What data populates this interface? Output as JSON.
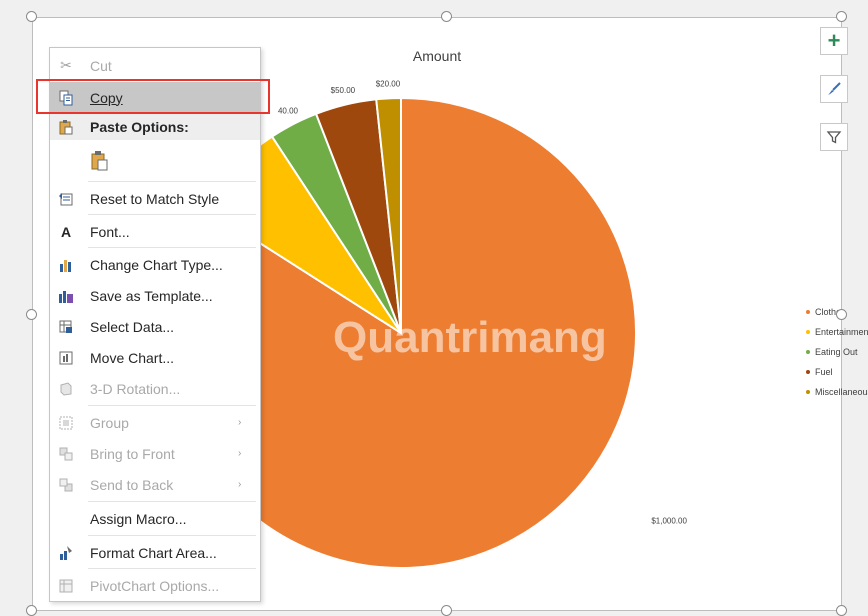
{
  "chart_data": {
    "type": "pie",
    "title": "Amount",
    "categories": [
      "Clothes",
      "Entertainment",
      "Eating Out",
      "Fuel",
      "Miscellaneous"
    ],
    "values": [
      1000,
      80,
      40,
      50,
      20
    ],
    "data_labels": [
      "$1,000.00",
      "",
      "40.00",
      "$50.00",
      "$20.00"
    ],
    "colors": [
      "#ed7d31",
      "#ffc000",
      "#70ad47",
      "#9e480e",
      "#bf8f00"
    ],
    "legend_position": "right"
  },
  "context_menu": {
    "items": [
      {
        "label": "Cut",
        "icon": "scissors-icon",
        "enabled": false
      },
      {
        "label": "Copy",
        "icon": "copy-icon",
        "enabled": true,
        "highlighted": true
      },
      {
        "label": "Paste Options:",
        "icon": "paste-icon",
        "enabled": true,
        "header": true
      },
      {
        "label": "Reset to Match Style",
        "icon": "reset-style-icon",
        "enabled": true
      },
      {
        "label": "Font...",
        "icon": "font-icon",
        "enabled": true
      },
      {
        "label": "Change Chart Type...",
        "icon": "chart-type-icon",
        "enabled": true
      },
      {
        "label": "Save as Template...",
        "icon": "save-template-icon",
        "enabled": true
      },
      {
        "label": "Select Data...",
        "icon": "select-data-icon",
        "enabled": true
      },
      {
        "label": "Move Chart...",
        "icon": "move-chart-icon",
        "enabled": true
      },
      {
        "label": "3-D Rotation...",
        "icon": "rotation-icon",
        "enabled": false
      },
      {
        "label": "Group",
        "icon": "group-icon",
        "enabled": false,
        "submenu": true
      },
      {
        "label": "Bring to Front",
        "icon": "bring-front-icon",
        "enabled": false,
        "submenu": true
      },
      {
        "label": "Send to Back",
        "icon": "send-back-icon",
        "enabled": false,
        "submenu": true
      },
      {
        "label": "Assign Macro...",
        "icon": "",
        "enabled": true
      },
      {
        "label": "Format Chart Area...",
        "icon": "format-area-icon",
        "enabled": true
      },
      {
        "label": "PivotChart Options...",
        "icon": "pivot-icon",
        "enabled": false
      }
    ]
  },
  "side_buttons": [
    {
      "icon": "plus-icon",
      "glyph": "+"
    },
    {
      "icon": "brush-icon",
      "glyph": "🖌"
    },
    {
      "icon": "filter-icon",
      "glyph": "⛉"
    }
  ],
  "watermark": "Quantrimang",
  "colors": {
    "highlight": "#c7c7c7",
    "outline": "#e8362f",
    "accent_green": "#2e8b57"
  }
}
